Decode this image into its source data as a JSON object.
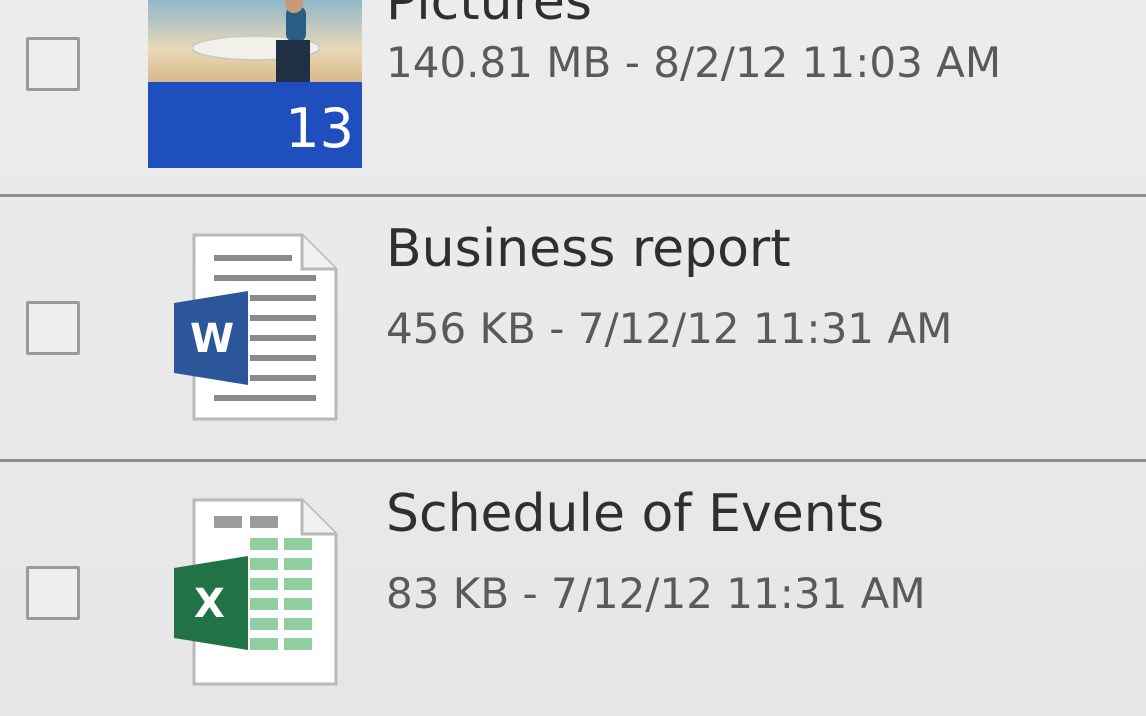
{
  "files": [
    {
      "name": "Pictures",
      "meta": "140.81 MB - 8/2/12 11:03 AM",
      "type": "folder",
      "icon": "pictures-folder-thumbnail",
      "count": "13"
    },
    {
      "name": "Business report",
      "meta": "456 KB - 7/12/12 11:31 AM",
      "type": "word-document",
      "icon": "word-document-icon",
      "badge": "W"
    },
    {
      "name": "Schedule of Events",
      "meta": "83 KB - 7/12/12 11:31 AM",
      "type": "excel-spreadsheet",
      "icon": "excel-spreadsheet-icon",
      "badge": "X"
    }
  ],
  "colors": {
    "word": "#2b579a",
    "excel": "#217346",
    "folder_overlay": "#1f4fbf"
  }
}
